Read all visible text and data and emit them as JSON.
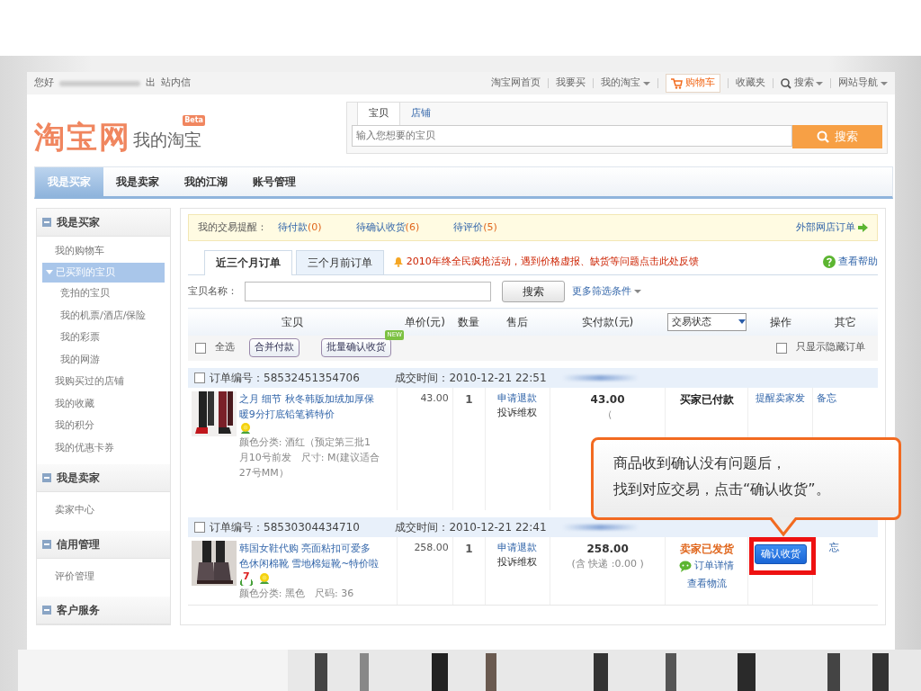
{
  "top_bar": {
    "greeting": "您好",
    "logout_fragment": "出",
    "messages": "站内信",
    "nav": [
      {
        "label": "淘宝网首页",
        "kind": "link"
      },
      {
        "label": "我要买",
        "kind": "link"
      },
      {
        "label": "我的淘宝",
        "kind": "dropdown"
      },
      {
        "label": "购物车",
        "kind": "cart"
      },
      {
        "label": "收藏夹",
        "kind": "link"
      },
      {
        "label": "搜索",
        "kind": "search"
      },
      {
        "label": "网站导航",
        "kind": "dropdown"
      }
    ]
  },
  "logo": {
    "brand": "淘宝网",
    "subtitle": "我的淘宝",
    "badge": "Beta"
  },
  "search": {
    "tabs": [
      {
        "label": "宝贝",
        "selected": true
      },
      {
        "label": "店铺",
        "selected": false
      }
    ],
    "placeholder": "输入您想要的宝贝",
    "button": "搜索"
  },
  "main_tabs": [
    {
      "label": "我是买家",
      "selected": true
    },
    {
      "label": "我是卖家",
      "selected": false
    },
    {
      "label": "我的江湖",
      "selected": false
    },
    {
      "label": "账号管理",
      "selected": false
    }
  ],
  "sidebar": [
    {
      "title": "我是买家",
      "items": [
        {
          "label": "我的购物车",
          "selected": false
        },
        {
          "label": "已买到的宝贝",
          "selected": true,
          "children": [
            {
              "label": "竞拍的宝贝",
              "selected": false
            },
            {
              "label": "我的机票/酒店/保险",
              "selected": false
            },
            {
              "label": "我的彩票",
              "selected": false
            },
            {
              "label": "我的网游",
              "selected": false
            }
          ]
        },
        {
          "label": "我购买过的店铺",
          "selected": false
        },
        {
          "label": "我的收藏",
          "selected": false
        },
        {
          "label": "我的积分",
          "selected": false
        },
        {
          "label": "我的优惠卡券",
          "selected": false
        }
      ]
    },
    {
      "title": "我是卖家",
      "items": [
        {
          "label": "卖家中心",
          "selected": false
        }
      ]
    },
    {
      "title": "信用管理",
      "items": [
        {
          "label": "评价管理",
          "selected": false
        }
      ]
    },
    {
      "title": "客户服务"
    }
  ],
  "reminders": {
    "label": "我的交易提醒：",
    "items": [
      {
        "label": "待付款",
        "count": "(0)"
      },
      {
        "label": "待确认收货",
        "count": "(6)"
      },
      {
        "label": "待评价",
        "count": "(5)"
      }
    ],
    "external": "外部网店订单"
  },
  "order_tabs": [
    {
      "label": "近三个月订单",
      "selected": true
    },
    {
      "label": "三个月前订单",
      "selected": false
    }
  ],
  "notice": "2010年终全民疯抢活动，遇到价格虚报、缺货等问题点击此处反馈",
  "help": "查看帮助",
  "filter": {
    "label": "宝贝名称：",
    "button": "搜索",
    "more": "更多筛选条件"
  },
  "columns": [
    "宝贝",
    "单价(元)",
    "数量",
    "售后",
    "实付款(元)",
    "交易状态",
    "操作",
    "其它"
  ],
  "toolbar": {
    "select_all": {
      "label": "全选",
      "checked": false
    },
    "merge": "合并付款",
    "batch": "批量确认收货",
    "new_badge": "NEW",
    "hidden_only": {
      "label": "只显示隐藏订单",
      "checked": false
    }
  },
  "orders": [
    {
      "checked": false,
      "number": "订单编号：58532451354706",
      "time": "成交时间：2010-12-21 22:51",
      "title": "之月 细节 秋冬韩版加绒加厚保暖9分打底铅笔裤特价",
      "icons": [
        {
          "kind": "flower"
        }
      ],
      "specs": "颜色分类: 酒红（预定第三批1月10号前发　尺寸: M(建议适合27号MM）",
      "price": "43.00",
      "qty": "1",
      "after_sales": [
        "申请退款",
        "投诉维权"
      ],
      "paid": "43.00",
      "paid_note": "（",
      "status": {
        "label": "买家已付款",
        "color": "#222222"
      },
      "action": {
        "kind": "link",
        "label": "提醒卖家发"
      },
      "other": "备忘"
    },
    {
      "checked": false,
      "number": "订单编号：58530304434710",
      "time": "成交时间：2010-12-21 22:41",
      "title": "韩国女鞋代购 亮面粘扣可爱多色休闲棉靴 雪地棉短靴~特价啦",
      "icons": [
        {
          "kind": "return",
          "label": "7"
        },
        {
          "kind": "flower"
        }
      ],
      "specs": "颜色分类: 黑色　尺码: 36",
      "price": "258.00",
      "qty": "1",
      "after_sales": [
        "申请退款",
        "投诉维权"
      ],
      "paid": "258.00",
      "paid_note": "(含 快递 :0.00 )",
      "status": {
        "label": "卖家已发货",
        "color": "#e0661c"
      },
      "status_links": [
        {
          "label": "订单详情",
          "kind": "chat"
        },
        {
          "label": "查看物流",
          "kind": "link"
        }
      ],
      "action": {
        "kind": "button",
        "label": "确认收货"
      },
      "other": "忘"
    }
  ],
  "callout": [
    "商品收到确认没有问题后，",
    "找到对应交易，点击“确认收货”。"
  ]
}
